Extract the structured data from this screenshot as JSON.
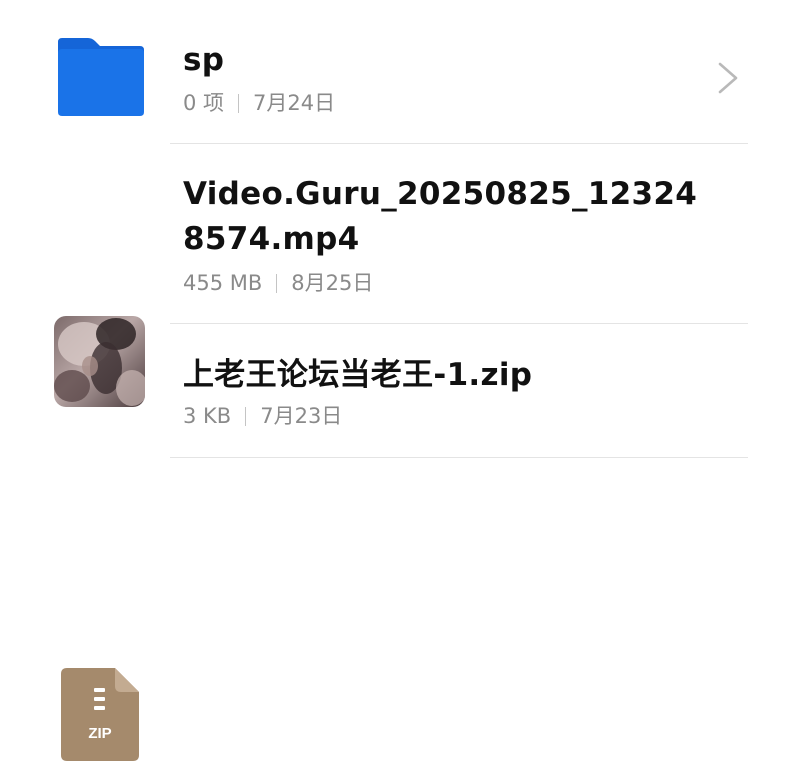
{
  "files": [
    {
      "name": "sp",
      "count": "0 项",
      "date": "7月24日",
      "icon": "folder-icon",
      "icon_color": "#1a73e8"
    },
    {
      "name_line1": "Video.Guru_20250825_12324",
      "name_line2": "8574.mp4",
      "size": "455 MB",
      "date": "8月25日",
      "icon": "video-thumbnail"
    },
    {
      "name": "上老王论坛当老王-1.zip",
      "size": "3 KB",
      "date": "7月23日",
      "icon": "zip-icon",
      "icon_label": "ZIP",
      "icon_color": "#a58a6c"
    }
  ]
}
